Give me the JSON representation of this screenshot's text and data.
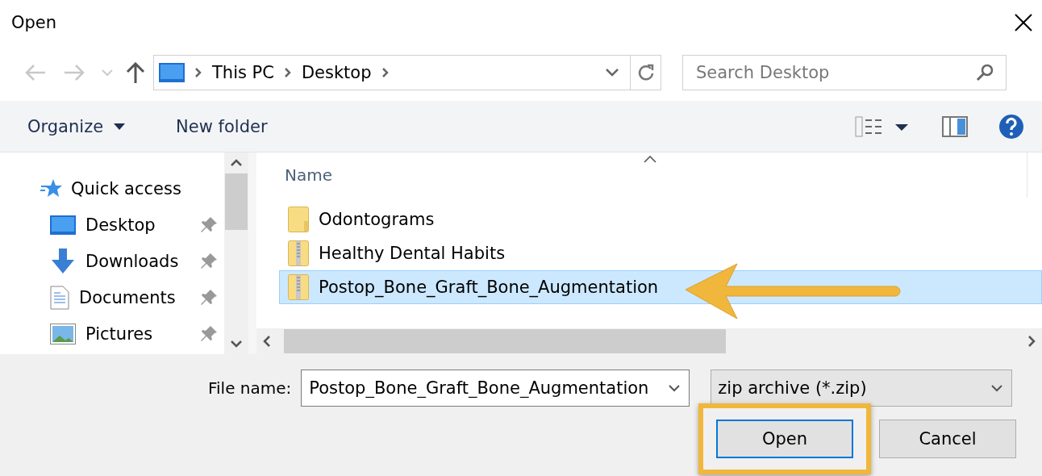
{
  "window": {
    "title": "Open"
  },
  "nav": {
    "back_disabled": true,
    "forward_disabled": true,
    "breadcrumbs": [
      "This PC",
      "Desktop"
    ]
  },
  "search": {
    "placeholder": "Search Desktop"
  },
  "toolbar": {
    "items": [
      {
        "label": "Organize",
        "kind": "menu"
      },
      {
        "label": "New folder",
        "kind": "button"
      }
    ]
  },
  "sidebar": {
    "items": [
      {
        "label": "Quick access",
        "kind": "star",
        "pinned": false
      },
      {
        "label": "Desktop",
        "kind": "desktop",
        "pinned": true
      },
      {
        "label": "Downloads",
        "kind": "download",
        "pinned": true
      },
      {
        "label": "Documents",
        "kind": "document",
        "pinned": true
      },
      {
        "label": "Pictures",
        "kind": "pictures",
        "pinned": true
      }
    ]
  },
  "files": {
    "columns": [
      "Name"
    ],
    "rows": [
      {
        "name": "Odontograms",
        "kind": "folder",
        "selected": false,
        "pointed": false
      },
      {
        "name": "Healthy Dental Habits",
        "kind": "zip",
        "selected": false,
        "pointed": false
      },
      {
        "name": "Postop_Bone_Graft_Bone_Augmentation",
        "kind": "zip",
        "selected": true,
        "pointed": true
      }
    ]
  },
  "footer": {
    "file_name_label": "File name:",
    "file_name": "Postop_Bone_Graft_Bone_Augmentation",
    "file_type": "zip archive (*.zip)",
    "buttons": [
      {
        "label": "Open",
        "kind": "primary",
        "highlighted": true
      },
      {
        "label": "Cancel",
        "kind": "secondary",
        "highlighted": false
      }
    ]
  }
}
